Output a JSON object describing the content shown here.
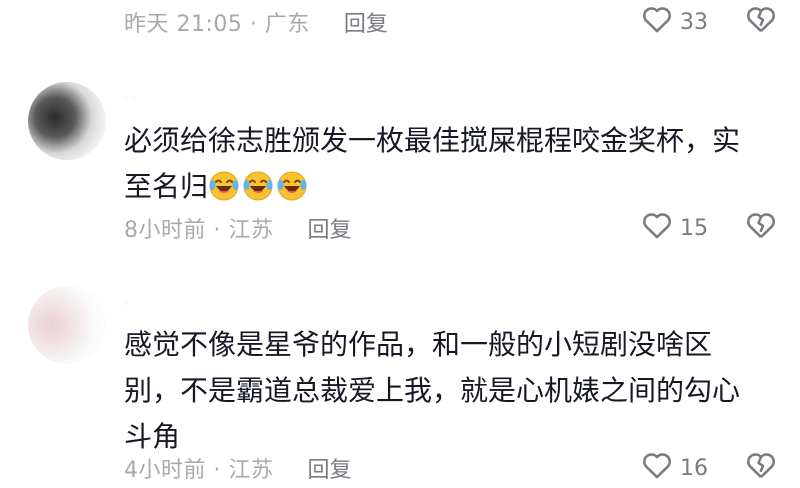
{
  "comments": [
    {
      "time_location": "昨天 21:05 · 广东",
      "reply_label": "回复",
      "likes": "33"
    },
    {
      "username": "· ·",
      "text": "必须给徐志胜颁发一枚最佳搅屎棍程咬金奖杯，实至名归",
      "emoji_count": 3,
      "emoji_icon": "laughing-tears-emoji",
      "time_location": "8小时前 · 江苏",
      "reply_label": "回复",
      "likes": "15"
    },
    {
      "username": "·",
      "text": "感觉不像是星爷的作品，和一般的小短剧没啥区别，不是霸道总裁爱上我，就是心机婊之间的勾心斗角",
      "time_location": "4小时前 · 江苏",
      "reply_label": "回复",
      "likes": "16"
    }
  ],
  "colors": {
    "meta_text": "#a8a9ad",
    "reply_text": "#7a7b80",
    "body_text": "#161823",
    "emoji_face": "#f7c22d"
  }
}
